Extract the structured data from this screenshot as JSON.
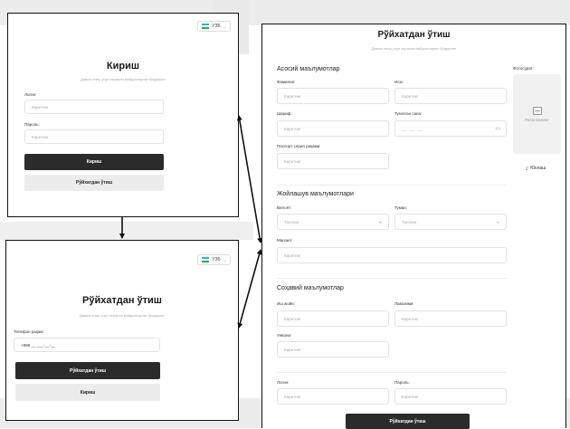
{
  "lang": {
    "code": "УЗБ",
    "chevron": "⌄"
  },
  "login": {
    "title": "Кириш",
    "subtitle": "Давом этиш учун керакли майдонларни тўлдиринг",
    "login_label": "Логин:",
    "login_placeholder": "Киритинг",
    "password_label": "Пароль:",
    "password_placeholder": "Киритинг",
    "submit": "Кириш",
    "register": "Рўйхатдан ўтиш"
  },
  "phone_reg": {
    "title": "Рўйхатдан ўтиш",
    "subtitle": "Давом этиш учун керакли майдонларни тўлдиринг",
    "phone_label": "Телефон рақам:",
    "phone_value": "+998 __ ___-__-__",
    "submit": "Рўйхатдан ўтиш",
    "login": "Кириш"
  },
  "full_reg": {
    "title": "Рўйхатдан ўтиш",
    "subtitle": "Давом этиш учун керакли майдонларни тўлдиринг",
    "basic_section": "Асосий маълумотлар",
    "surname_label": "Фамилия:",
    "name_label": "Исм:",
    "patronymic_label": "Шариф:",
    "birthdate_label": "Туғилган сана:",
    "birthdate_value": "__ . __ . __",
    "passport_label": "Паспорт серия рақами:",
    "placeholder": "Киритинг",
    "photo_label": "Фотосурат:",
    "photo_text": "Расм юкланг",
    "upload_label": "Юклаш",
    "address_section": "Жойлашув маълумотлари",
    "region_label": "Вилоят:",
    "district_label": "Туман:",
    "select_placeholder": "Танланг",
    "address_label": "Манзил:",
    "social_section": "Соҳавий маълумотлар",
    "workplace_label": "Иш жойи:",
    "position_label": "Лавозими:",
    "degree_label": "Унвони:",
    "login_label": "Логин:",
    "password_label": "Пароль:",
    "submit": "Рўйхатдан ўтиш"
  }
}
